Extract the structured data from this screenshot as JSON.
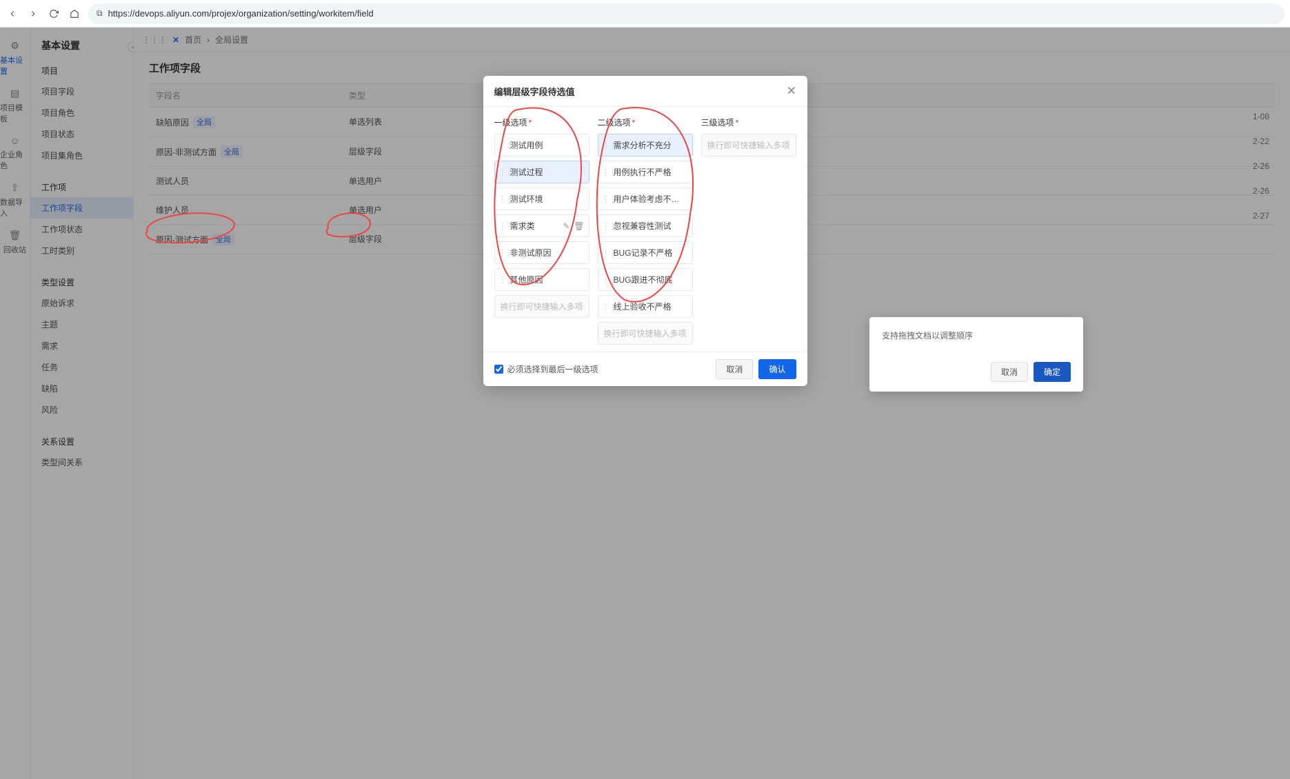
{
  "browser": {
    "url": "https://devops.aliyun.com/projex/organization/setting/workitem/field"
  },
  "topbar": {
    "home": "首页",
    "global": "全局设置"
  },
  "leftrail": [
    {
      "label": "基本设置",
      "icon": "gear",
      "active": true
    },
    {
      "label": "项目模板",
      "icon": "template",
      "active": false
    },
    {
      "label": "企业角色",
      "icon": "user",
      "active": false
    },
    {
      "label": "数据导入",
      "icon": "import",
      "active": false
    },
    {
      "label": "回收站",
      "icon": "trash",
      "active": false
    }
  ],
  "sidebar": {
    "title": "基本设置",
    "groups": [
      {
        "items": [
          "项目",
          "项目字段",
          "项目角色",
          "项目状态",
          "项目集角色"
        ]
      },
      {
        "items": [
          "工作项",
          "工作项字段",
          "工作项状态",
          "工时类别"
        ]
      },
      {
        "items": [
          "类型设置",
          "原始诉求",
          "主题",
          "需求",
          "任务",
          "缺陷",
          "风险"
        ]
      },
      {
        "items": [
          "关系设置",
          "类型间关系"
        ]
      }
    ],
    "active": "工作项字段"
  },
  "content": {
    "title": "工作项字段",
    "head": {
      "c1": "字段名",
      "c2": "类型"
    },
    "rows": [
      {
        "name": "缺陷原因",
        "tag": "全局",
        "type": "单选列表",
        "time": "1-08"
      },
      {
        "name": "原因-非测试方面",
        "tag": "全局",
        "type": "层级字段",
        "time": "2-22"
      },
      {
        "name": "测试人员",
        "tag": "",
        "type": "单选用户",
        "time": "2-26"
      },
      {
        "name": "维护人员",
        "tag": "",
        "type": "单选用户",
        "time": "2-26"
      },
      {
        "name": "原因-测试方面",
        "tag": "全局",
        "type": "层级字段",
        "time": "2-27"
      }
    ]
  },
  "innerModal": {
    "message": "支持拖拽文档以调整顺序",
    "cancel": "取消",
    "confirm": "确定"
  },
  "modal": {
    "title": "编辑层级字段待选值",
    "levels": {
      "l1": "一级选项",
      "l2": "二级选项",
      "l3": "三级选项"
    },
    "col1": {
      "items": [
        "测试用例",
        "测试过程",
        "测试环境",
        "需求类",
        "非测试原因",
        "其他原因"
      ],
      "selected": 1,
      "toolsOn": 3,
      "placeholder": "换行即可快捷输入多项"
    },
    "col2": {
      "items": [
        "需求分析不充分",
        "用例执行不严格",
        "用户体验考虑不…",
        "忽视兼容性测试",
        "BUG记录不严格",
        "BUG跟进不彻底",
        "线上验收不严格"
      ],
      "selected": 0,
      "placeholder": "换行即可快捷输入多项"
    },
    "col3": {
      "placeholder": "换行即可快捷输入多项"
    },
    "footer": {
      "checkbox": "必须选择到最后一级选项",
      "cancel": "取消",
      "confirm": "确认"
    }
  }
}
